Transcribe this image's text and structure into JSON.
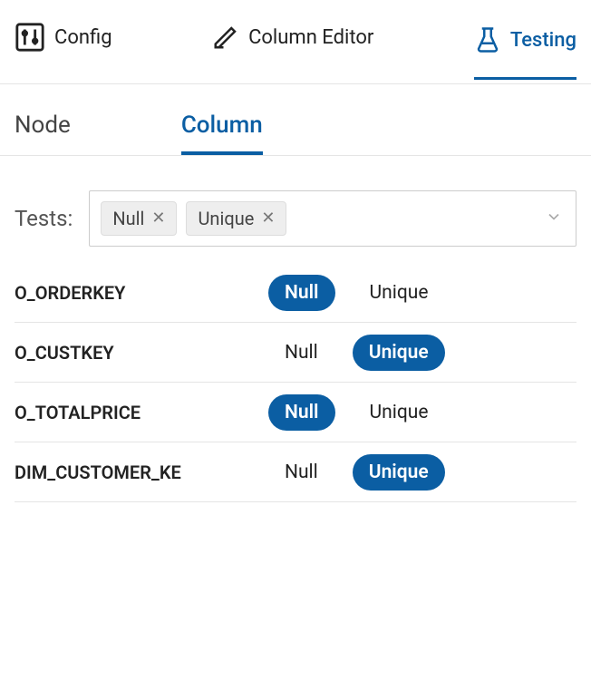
{
  "topnav": {
    "config": "Config",
    "column_editor": "Column Editor",
    "testing": "Testing"
  },
  "subnav": {
    "node": "Node",
    "column": "Column"
  },
  "tests": {
    "label": "Tests:",
    "tags": [
      "Null",
      "Unique"
    ]
  },
  "columns": [
    {
      "name": "O_ORDERKEY",
      "null_on": true,
      "unique_on": false
    },
    {
      "name": "O_CUSTKEY",
      "null_on": false,
      "unique_on": true
    },
    {
      "name": "O_TOTALPRICE",
      "null_on": true,
      "unique_on": false
    },
    {
      "name": "DIM_CUSTOMER_KEY",
      "null_on": false,
      "unique_on": true
    }
  ],
  "pill_labels": {
    "null": "Null",
    "unique": "Unique"
  }
}
